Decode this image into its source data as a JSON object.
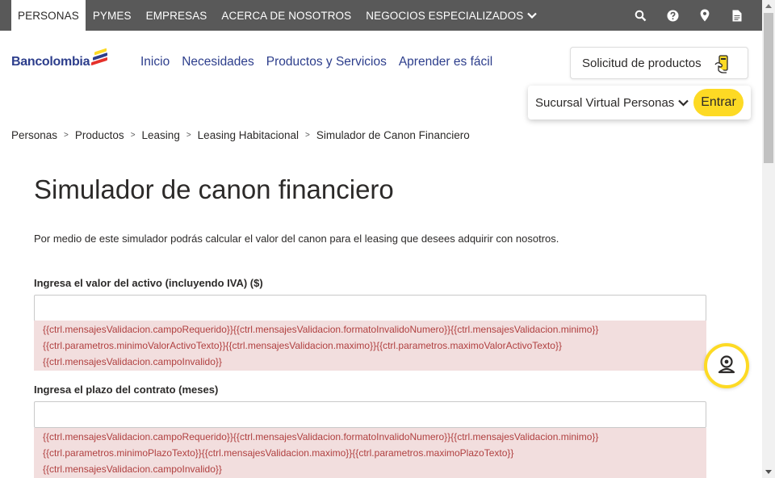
{
  "topbar": {
    "tabs": [
      "PERSONAS",
      "PYMES",
      "EMPRESAS",
      "ACERCA DE NOSOTROS",
      "NEGOCIOS ESPECIALIZADOS"
    ],
    "icons": [
      "search-icon",
      "help-icon",
      "location-pin-icon",
      "document-icon"
    ]
  },
  "header": {
    "logo_text": "Bancolombia",
    "nav": [
      "Inicio",
      "Necesidades",
      "Productos y Servicios",
      "Aprender es fácil"
    ],
    "solicitud_label": "Solicitud de productos",
    "sucursal_label": "Sucursal Virtual Personas",
    "entrar_label": "Entrar"
  },
  "breadcrumb": [
    "Personas",
    "Productos",
    "Leasing",
    "Leasing Habitacional",
    "Simulador de Canon Financiero"
  ],
  "breadcrumb_separator": ">",
  "page": {
    "title": "Simulador de canon financiero",
    "description": "Por medio de este simulador podrás calcular el valor del canon para el leasing que desees adquirir con nosotros.",
    "field1": {
      "label": "Ingresa el valor del activo (incluyendo IVA) ($)",
      "value": "",
      "errors": [
        "{{ctrl.mensajesValidacion.campoRequerido}}{{ctrl.mensajesValidacion.formatoInvalidoNumero}}{{ctrl.mensajesValidacion.minimo}}",
        "{{ctrl.parametros.minimoValorActivoTexto}}{{ctrl.mensajesValidacion.maximo}}{{ctrl.parametros.maximoValorActivoTexto}}",
        "{{ctrl.mensajesValidacion.campoInvalido}}"
      ]
    },
    "field2": {
      "label": "Ingresa el plazo del contrato (meses)",
      "value": "",
      "errors": [
        "{{ctrl.mensajesValidacion.campoRequerido}}{{ctrl.mensajesValidacion.formatoInvalidoNumero}}{{ctrl.mensajesValidacion.minimo}}",
        "{{ctrl.parametros.minimoPlazoTexto}}{{ctrl.mensajesValidacion.maximo}}{{ctrl.parametros.maximoPlazoTexto}}",
        "{{ctrl.mensajesValidacion.campoInvalido}}"
      ]
    }
  },
  "colors": {
    "topbar_bg": "#595959",
    "brand_blue": "#2d3e8c",
    "accent_yellow": "#fdda24",
    "error_bg": "#f2dede",
    "error_text": "#b04040"
  }
}
